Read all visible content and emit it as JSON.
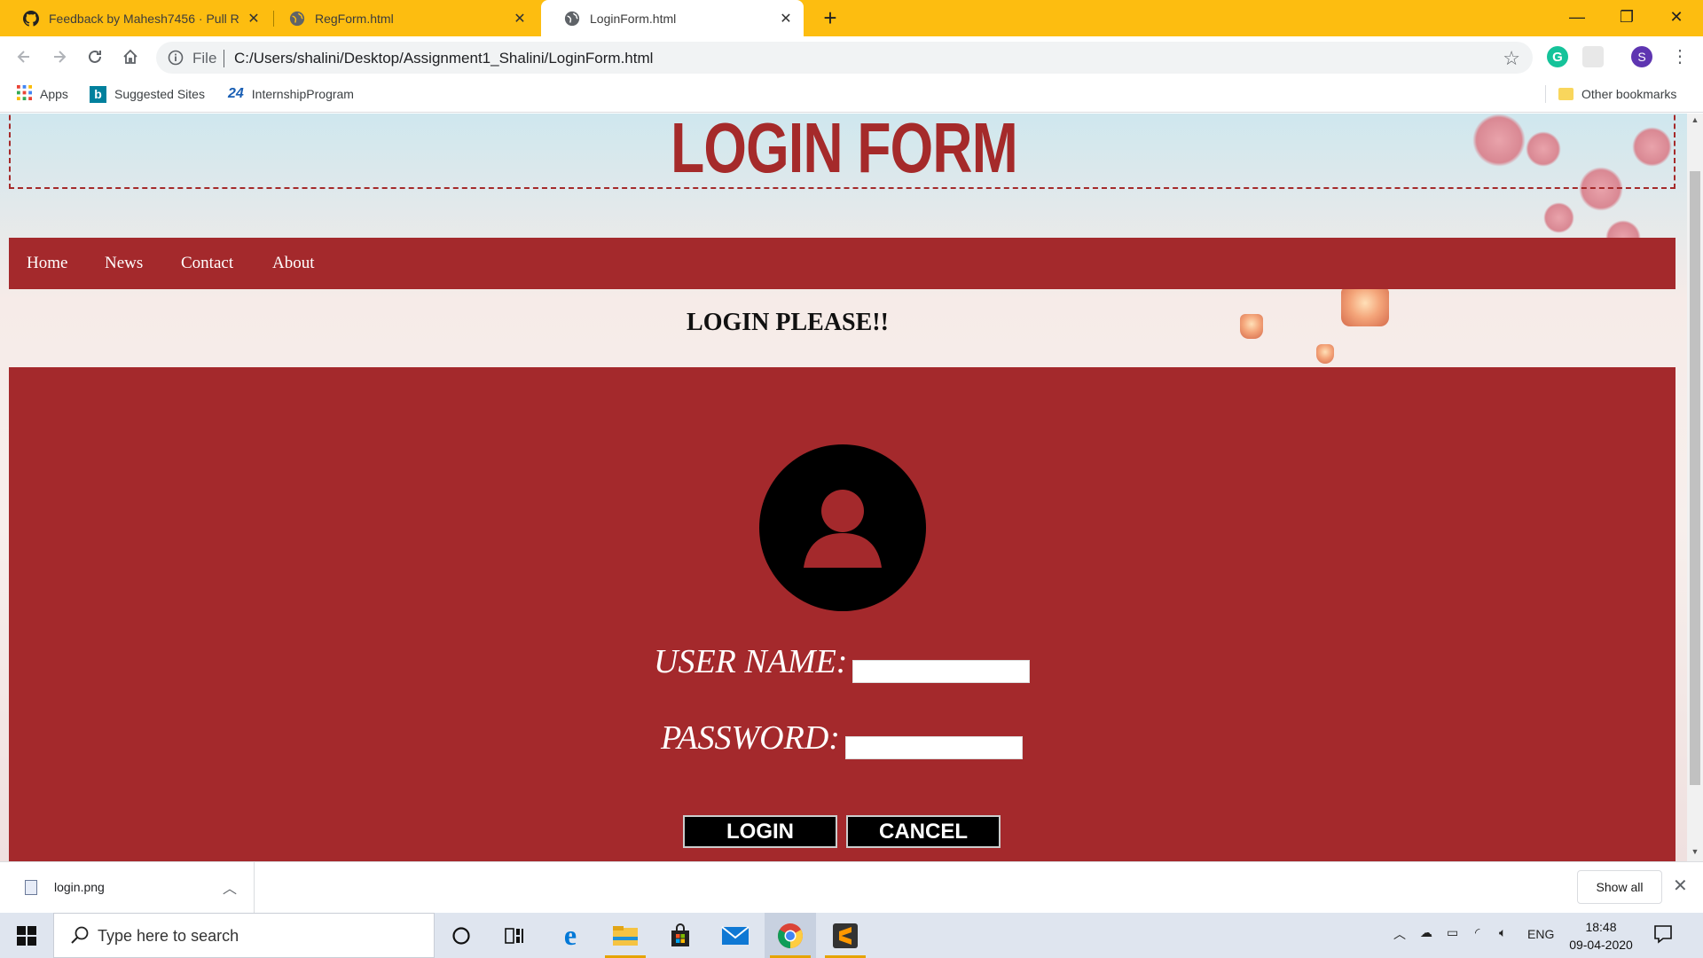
{
  "browser": {
    "tabs": [
      {
        "title": "Feedback by Mahesh7456 · Pull R",
        "active": false,
        "icon": "github-icon"
      },
      {
        "title": "RegForm.html",
        "active": false,
        "icon": "globe-icon"
      },
      {
        "title": "LoginForm.html",
        "active": true,
        "icon": "globe-icon"
      }
    ],
    "new_tab": "+",
    "address": {
      "scheme": "File",
      "url": "C:/Users/shalini/Desktop/Assignment1_Shalini/LoginForm.html"
    },
    "profile_initial": "S",
    "bookmarks": [
      {
        "label": "Apps",
        "icon": "apps-grid-icon"
      },
      {
        "label": "Suggested Sites",
        "icon": "bing-icon"
      },
      {
        "label": "InternshipProgram",
        "icon": "24-icon",
        "icon_text": "24"
      }
    ],
    "other_bookmarks": "Other bookmarks"
  },
  "page": {
    "title": "LOGIN FORM",
    "nav": [
      "Home",
      "News",
      "Contact",
      "About"
    ],
    "subheading": "LOGIN PLEASE!!",
    "form": {
      "username_label": "USER NAME:",
      "password_label": "PASSWORD:",
      "login_button": "LOGIN",
      "cancel_button": "CANCEL"
    },
    "colors": {
      "accent": "#a4292c",
      "title": "#a52a2a",
      "button": "#000000"
    }
  },
  "downloads": {
    "file": "login.png",
    "show_all": "Show all"
  },
  "taskbar": {
    "search_placeholder": "Type here to search",
    "language": "ENG",
    "time": "18:48",
    "date": "09-04-2020",
    "apps": [
      "cortana-icon",
      "task-view-icon",
      "edge-icon",
      "file-explorer-icon",
      "store-icon",
      "mail-icon",
      "chrome-icon",
      "sublime-icon"
    ]
  }
}
